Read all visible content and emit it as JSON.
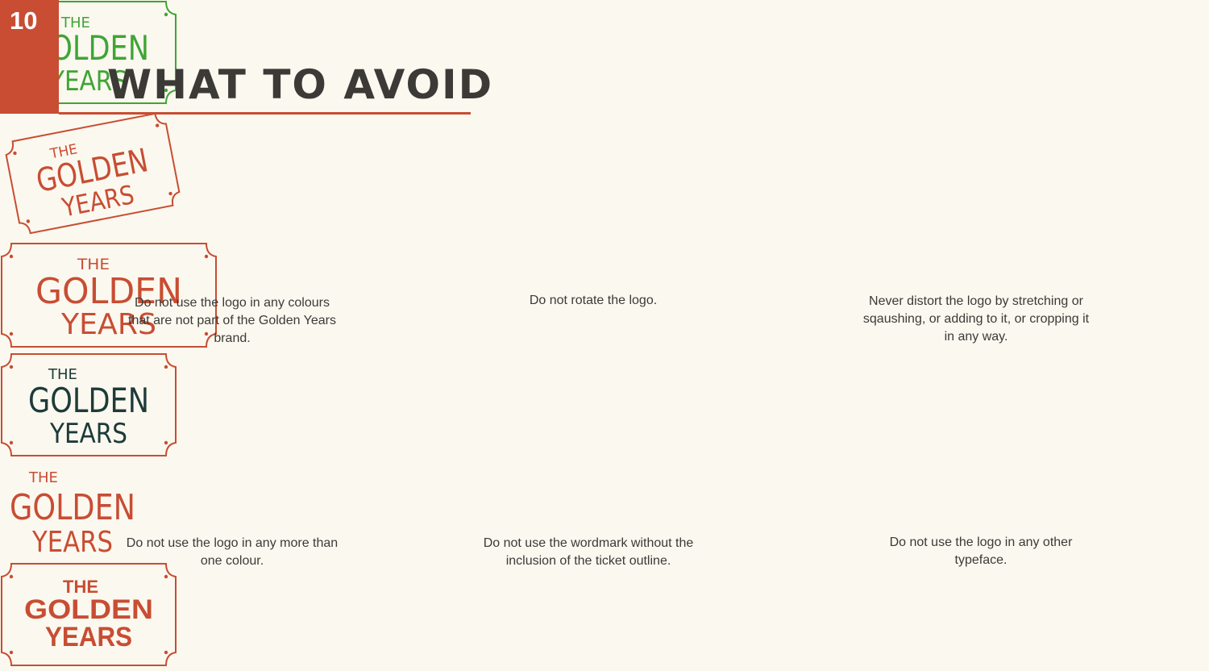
{
  "page": {
    "number": "10",
    "title": "WHAT TO AVOID",
    "accent_color": "#c84d33"
  },
  "colors": {
    "brand_red": "#c84d33",
    "wrong_green": "#3fa535",
    "dark_teal": "#1d3b3a",
    "text_dark": "#3b3a37",
    "background": "#fbf8ef"
  },
  "examples": [
    {
      "logo": {
        "the": "THE",
        "golden": "GOLDEN",
        "years": "YEARS"
      },
      "caption": "Do not use the logo in any colours that are not part of the Golden Years brand."
    },
    {
      "logo": {
        "the": "THE",
        "golden": "GOLDEN",
        "years": "YEARS"
      },
      "caption": "Do not rotate the logo."
    },
    {
      "logo": {
        "the": "THE",
        "golden": "GOLDEN",
        "years": "YEARS"
      },
      "caption": "Never distort the logo by stretching or sqaushing, or adding to it, or cropping it in any way."
    },
    {
      "logo": {
        "the": "THE",
        "golden": "GOLDEN",
        "years": "YEARS"
      },
      "caption": "Do not use the logo in any more than one colour."
    },
    {
      "logo": {
        "the": "THE",
        "golden": "GOLDEN",
        "years": "YEARS"
      },
      "caption": "Do not use the wordmark without the inclusion of the ticket outline."
    },
    {
      "logo": {
        "the": "THE",
        "golden": "GOLDEN",
        "years": "YEARS"
      },
      "caption": "Do not use the logo in any other typeface."
    }
  ]
}
